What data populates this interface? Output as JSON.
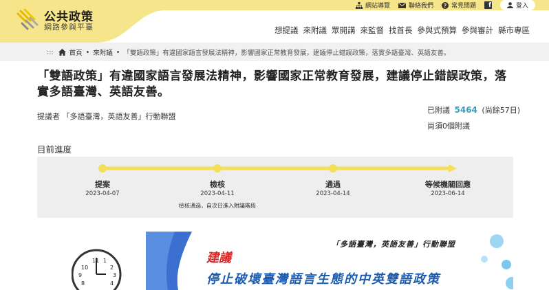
{
  "header": {
    "logo_title": "公共政策",
    "logo_subtitle": "網路參與平臺",
    "util_links": [
      {
        "label": "網站導覽",
        "icon": "sitemap-icon"
      },
      {
        "label": "聯絡我們",
        "icon": "mail-icon"
      },
      {
        "label": "常見問題",
        "icon": "question-icon"
      }
    ],
    "login_label": "登入",
    "nav": [
      "想提議",
      "來附議",
      "眾開講",
      "來監督",
      "找首長",
      "參與式預算",
      "參與審計",
      "縣市專區"
    ],
    "brand_yellow": "#f6e58a"
  },
  "breadcrumb": {
    "home": "首頁",
    "section": "來附議",
    "current": "「雙語政策」有違國家語言發展法精神，影響國家正常教育發展，建議停止錯誤政策，落實多語臺灣、英語友善。"
  },
  "proposal": {
    "title": "「雙語政策」有違國家語言發展法精神，影響國家正常教育發展，建議停止錯誤政策，落實多語臺灣、英語友善。",
    "proposer": "提議者 「多語臺灣，英語友善」行動聯盟",
    "signed_prefix": "已附議",
    "signed_count": "5464",
    "signed_suffix": "(尚餘57日)",
    "needed": "尚須0個附議"
  },
  "progress": {
    "label": "目前進度",
    "stages": [
      {
        "name": "提案",
        "date": "2023-04-07",
        "note": ""
      },
      {
        "name": "檢核",
        "date": "2023-04-11",
        "note": "檢核通過，自次日進入附議階段"
      },
      {
        "name": "通過",
        "date": "2023-04-14",
        "note": ""
      },
      {
        "name": "等候機關回應",
        "date": "2023-06-14",
        "note": ""
      }
    ],
    "track_color": "#f2df5a"
  },
  "banner": {
    "org": "「多語臺灣，英語友善」行動聯盟",
    "suggest": "建議",
    "headline": "停止破壞臺灣語言生態的中英雙語政策"
  }
}
